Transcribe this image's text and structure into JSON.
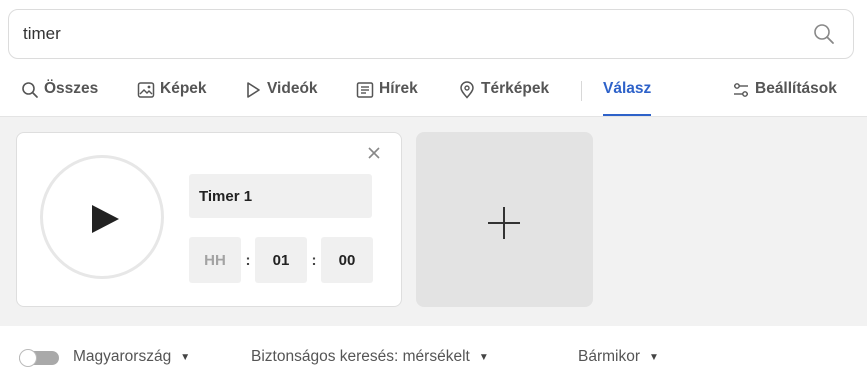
{
  "search": {
    "value": "timer",
    "icon": "search-icon"
  },
  "tabs": [
    {
      "label": "Összes",
      "icon": "search-icon"
    },
    {
      "label": "Képek",
      "icon": "image-icon"
    },
    {
      "label": "Videók",
      "icon": "play-icon"
    },
    {
      "label": "Hírek",
      "icon": "newspaper-icon"
    },
    {
      "label": "Térképek",
      "icon": "map-pin-icon"
    },
    {
      "label": "Válasz",
      "active": true
    },
    {
      "label": "Beállítások",
      "icon": "settings-sliders-icon"
    }
  ],
  "timer": {
    "name": "Timer 1",
    "hours": "HH",
    "minutes": "01",
    "seconds": "00",
    "separator": ":"
  },
  "footer": {
    "region": "Magyarország",
    "safe_search": "Biztonságos keresés: mérsékelt",
    "time": "Bármikor",
    "caret": "▼"
  },
  "colors": {
    "accent": "#2e62c9",
    "answer_bg": "#f2f2f2",
    "add_card": "#e3e3e3"
  }
}
